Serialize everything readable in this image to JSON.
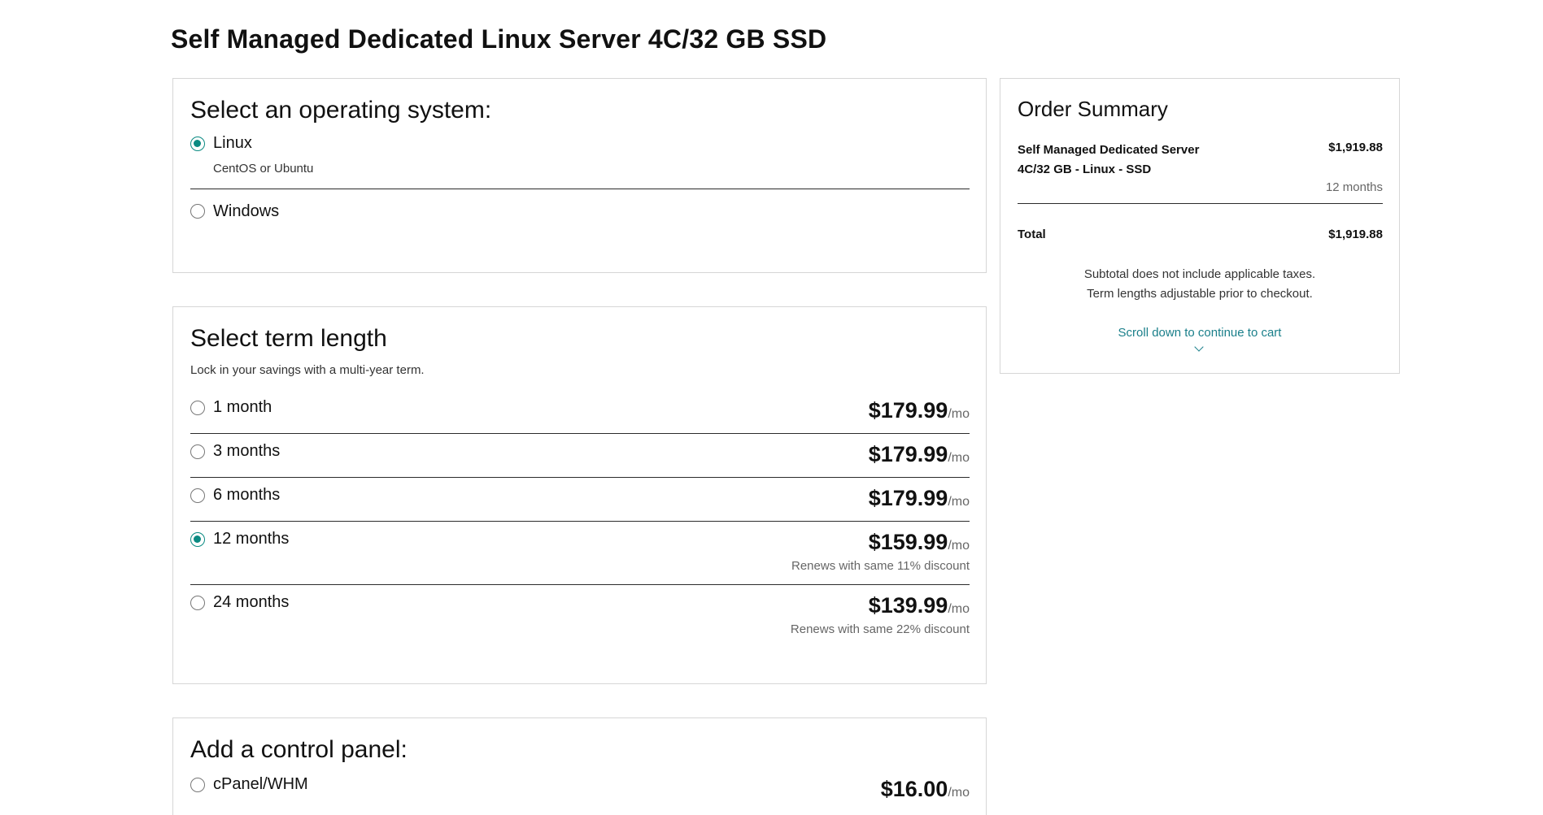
{
  "page": {
    "title": "Self Managed Dedicated Linux Server 4C/32 GB SSD"
  },
  "os_section": {
    "heading": "Select an operating system:",
    "options": [
      {
        "label": "Linux",
        "sublabel": "CentOS or Ubuntu",
        "selected": true
      },
      {
        "label": "Windows",
        "sublabel": "",
        "selected": false
      }
    ]
  },
  "term_section": {
    "heading": "Select term length",
    "subtitle": "Lock in your savings with a multi-year term.",
    "unit": "/mo",
    "options": [
      {
        "label": "1 month",
        "price": "$179.99",
        "note": "",
        "selected": false
      },
      {
        "label": "3 months",
        "price": "$179.99",
        "note": "",
        "selected": false
      },
      {
        "label": "6 months",
        "price": "$179.99",
        "note": "",
        "selected": false
      },
      {
        "label": "12 months",
        "price": "$159.99",
        "note": "Renews with same 11% discount",
        "selected": true
      },
      {
        "label": "24 months",
        "price": "$139.99",
        "note": "Renews with same 22% discount",
        "selected": false
      }
    ]
  },
  "control_panel_section": {
    "heading": "Add a control panel:",
    "unit": "/mo",
    "options": [
      {
        "label": "cPanel/WHM",
        "price": "$16.00",
        "selected": false
      }
    ]
  },
  "order_summary": {
    "heading": "Order Summary",
    "item_line1": "Self Managed Dedicated Server",
    "item_line2": "4C/32 GB - Linux - SSD",
    "item_price": "$1,919.88",
    "item_term": "12 months",
    "total_label": "Total",
    "total_value": "$1,919.88",
    "note_line1": "Subtotal does not include applicable taxes.",
    "note_line2": "Term lengths adjustable prior to checkout.",
    "scroll_link": "Scroll down to continue to cart"
  },
  "colors": {
    "accent": "#0a8a82",
    "link": "#1a7f8a",
    "border": "#d6d6d6"
  }
}
